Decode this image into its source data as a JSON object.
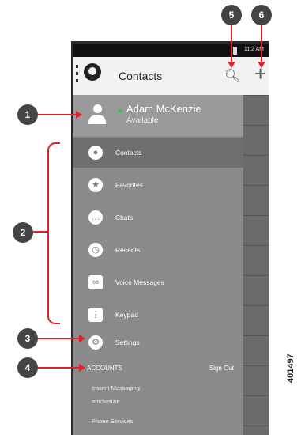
{
  "status_bar": {
    "time": "11:2 AM"
  },
  "app_bar": {
    "title": "Contacts"
  },
  "profile": {
    "name": "Adam McKenzie",
    "status": "Available"
  },
  "menu": [
    {
      "label": "Contacts",
      "icon": "person-icon"
    },
    {
      "label": "Favorites",
      "icon": "star-icon"
    },
    {
      "label": "Chats",
      "icon": "chat-icon"
    },
    {
      "label": "Recents",
      "icon": "clock-icon"
    },
    {
      "label": "Voice Messages",
      "icon": "voicemail-icon"
    },
    {
      "label": "Keypad",
      "icon": "keypad-icon"
    },
    {
      "label": "Settings",
      "icon": "gear-icon"
    }
  ],
  "accounts": {
    "header": "ACCOUNTS",
    "sign_out": "Sign Out",
    "im_label": "Instant Messaging",
    "im_user": "amckenzie",
    "phone_services": "Phone Services"
  },
  "callouts": [
    "1",
    "2",
    "3",
    "4",
    "5",
    "6"
  ],
  "figure_id": "401497",
  "colors": {
    "callout_arrow": "#e0202a",
    "presence_available": "#3cc24a"
  }
}
